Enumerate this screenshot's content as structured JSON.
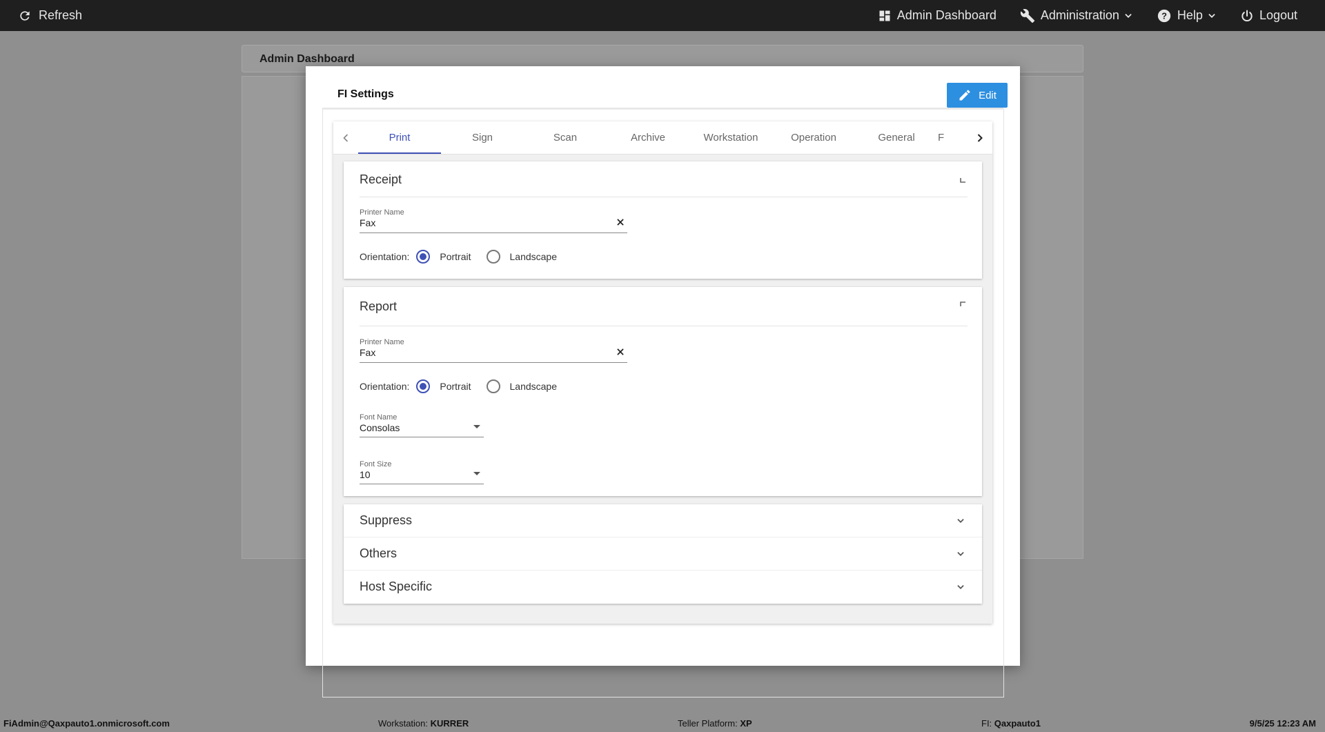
{
  "topbar": {
    "refresh_label": "Refresh",
    "admin_dashboard_label": "Admin Dashboard",
    "administration_label": "Administration",
    "help_label": "Help",
    "logout_label": "Logout"
  },
  "background": {
    "page_title": "Admin Dashboard"
  },
  "modal": {
    "title": "FI Settings",
    "edit_label": "Edit",
    "tabs": [
      "Print",
      "Sign",
      "Scan",
      "Archive",
      "Workstation",
      "Operation",
      "General",
      "F"
    ],
    "active_tab": "Print",
    "receipt": {
      "title": "Receipt",
      "printer_label": "Printer Name",
      "printer_value": "Fax",
      "orientation_label": "Orientation:",
      "portrait_label": "Portrait",
      "landscape_label": "Landscape",
      "orientation_selected": "Portrait"
    },
    "report": {
      "title": "Report",
      "printer_label": "Printer Name",
      "printer_value": "Fax",
      "orientation_label": "Orientation:",
      "portrait_label": "Portrait",
      "landscape_label": "Landscape",
      "orientation_selected": "Portrait",
      "font_name_label": "Font Name",
      "font_name_value": "Consolas",
      "font_size_label": "Font Size",
      "font_size_value": "10"
    },
    "collapsed_sections": [
      "Suppress",
      "Others",
      "Host Specific"
    ]
  },
  "statusbar": {
    "user": "FiAdmin@Qaxpauto1.onmicrosoft.com",
    "workstation_label": "Workstation:",
    "workstation_value": "KURRER",
    "platform_label": "Teller Platform:",
    "platform_value": "XP",
    "fi_label": "FI:",
    "fi_value": "Qaxpauto1",
    "datetime": "9/5/25 12:23 AM"
  },
  "colors": {
    "topbar_bg": "#1f1f1f",
    "accent": "#3f51b5",
    "edit_button": "#2d8fe0",
    "overlay_bg": "#8f8f8f"
  }
}
